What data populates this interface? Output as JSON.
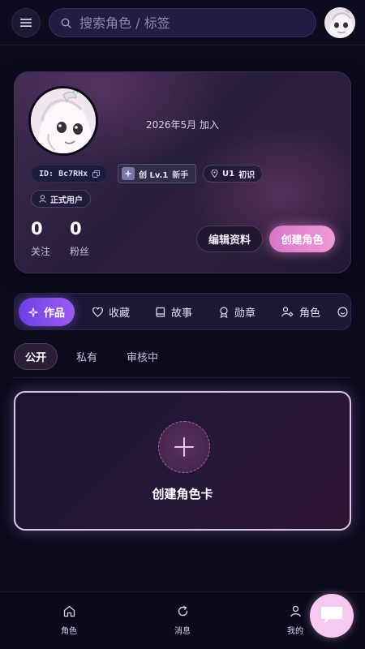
{
  "header": {
    "search_placeholder": "搜索角色 / 标签",
    "icons": [
      "menu-icon",
      "search-icon"
    ]
  },
  "profile": {
    "join_date": "2026年5月 加入",
    "user_id": "ID: Bc7RHx",
    "level_label": "创 Lv.1",
    "level_title": "新手",
    "u_level": "U1",
    "u_title": "初识",
    "role": "正式用户",
    "following_count": "0",
    "following_label": "关注",
    "followers_count": "0",
    "followers_label": "粉丝",
    "edit_label": "编辑资料",
    "create_label": "创建角色"
  },
  "tabs": [
    {
      "label": "作品",
      "icon": "sparkle-icon",
      "active": true
    },
    {
      "label": "收藏",
      "icon": "heart-icon"
    },
    {
      "label": "故事",
      "icon": "book-icon"
    },
    {
      "label": "勋章",
      "icon": "medal-icon"
    },
    {
      "label": "角色",
      "icon": "user-gear-icon"
    }
  ],
  "subtabs": [
    {
      "label": "公开",
      "active": true
    },
    {
      "label": "私有"
    },
    {
      "label": "审核中"
    }
  ],
  "create_card": {
    "label": "创建角色卡"
  },
  "bottom_nav": [
    {
      "label": "角色",
      "icon": "home-icon"
    },
    {
      "label": "消息",
      "icon": "refresh-icon"
    },
    {
      "label": "我的",
      "icon": "person-icon"
    }
  ],
  "colors": {
    "background": "#0d0a1c",
    "accent_pink": "#f09ad8",
    "accent_purple": "#8a52ee"
  }
}
